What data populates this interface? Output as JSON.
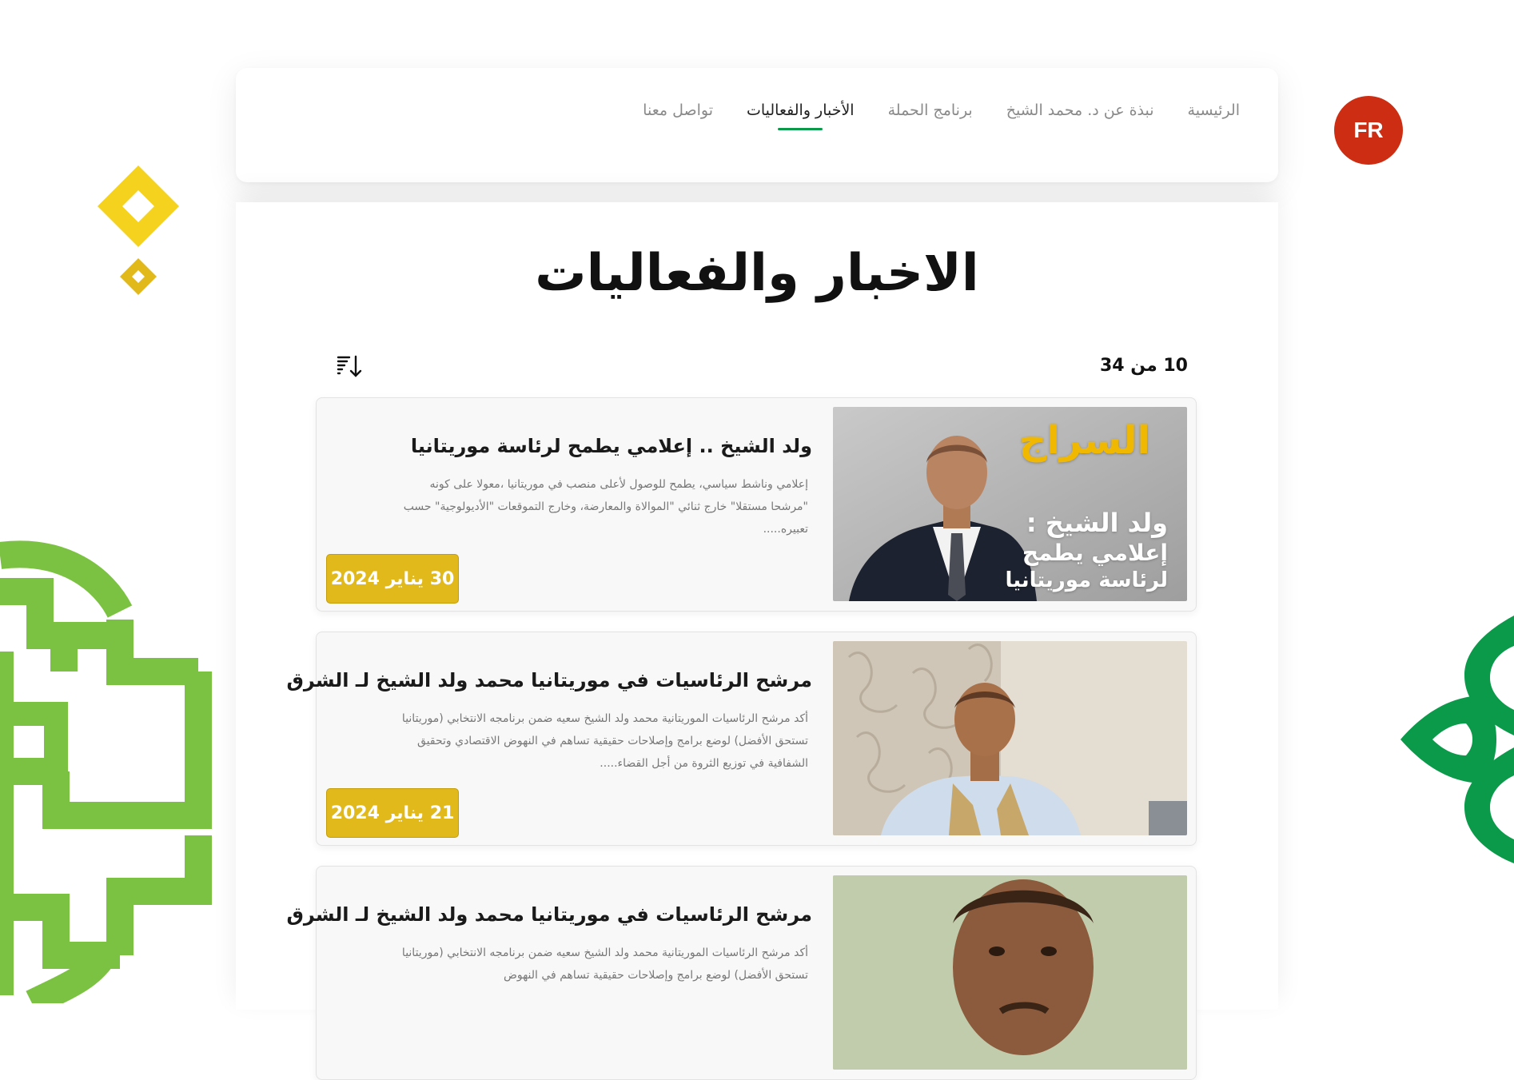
{
  "nav": {
    "items": [
      {
        "label": "الرئيسية",
        "active": false
      },
      {
        "label": "نبذة عن د. محمد الشيخ",
        "active": false
      },
      {
        "label": "برنامج الحملة",
        "active": false
      },
      {
        "label": "الأخبار والفعاليات",
        "active": true
      },
      {
        "label": "تواصل معنا",
        "active": false
      }
    ]
  },
  "lang_toggle": "FR",
  "page": {
    "title": "الاخبار والفعاليات",
    "count_text": "10 من 34",
    "sort_icon": "sort-descending-icon"
  },
  "articles": [
    {
      "title": "ولد الشيخ .. إعلامي يطمح لرئاسة موريتانيا",
      "excerpt": "إعلامي وناشط سياسي، يطمح للوصول لأعلى منصب في موريتانيا ،معولا على كونه \"مرشحا مستقلا\" خارج ثنائي \"الموالاة والمعارضة، وخارج التموقعات \"الأديولوجية\" حسب تعبيره.....",
      "date": "30 يناير 2024",
      "image_logo": "السراج",
      "image_caption": [
        "ولد الشيخ :",
        "إعلامي يطمح",
        "لرئاسة موريتانيا"
      ]
    },
    {
      "title": "مرشح الرئاسيات في موريتانيا محمد ولد الشيخ لـ الشرق",
      "excerpt": "أكد مرشح الرئاسيات الموريتانية محمد ولد الشيخ سعيه ضمن برنامجه الانتخابي (موريتانيا تستحق الأفضل) لوضع برامج وإصلاحات حقيقية تساهم في النهوض الاقتصادي وتحقيق الشفافية في توزيع الثروة من أجل القضاء.....",
      "date": "21 يناير 2024"
    },
    {
      "title": "مرشح الرئاسيات في موريتانيا محمد ولد الشيخ لـ الشرق",
      "excerpt": "أكد مرشح الرئاسيات الموريتانية محمد ولد الشيخ سعيه ضمن برنامجه الانتخابي (موريتانيا تستحق الأفضل) لوضع برامج وإصلاحات حقيقية تساهم في النهوض"
    }
  ],
  "colors": {
    "accent_green": "#0a9a4a",
    "lime_green": "#7cc242",
    "yellow": "#f5d21e",
    "badge_yellow": "#e1b91a",
    "fr_red": "#cd2d12"
  }
}
